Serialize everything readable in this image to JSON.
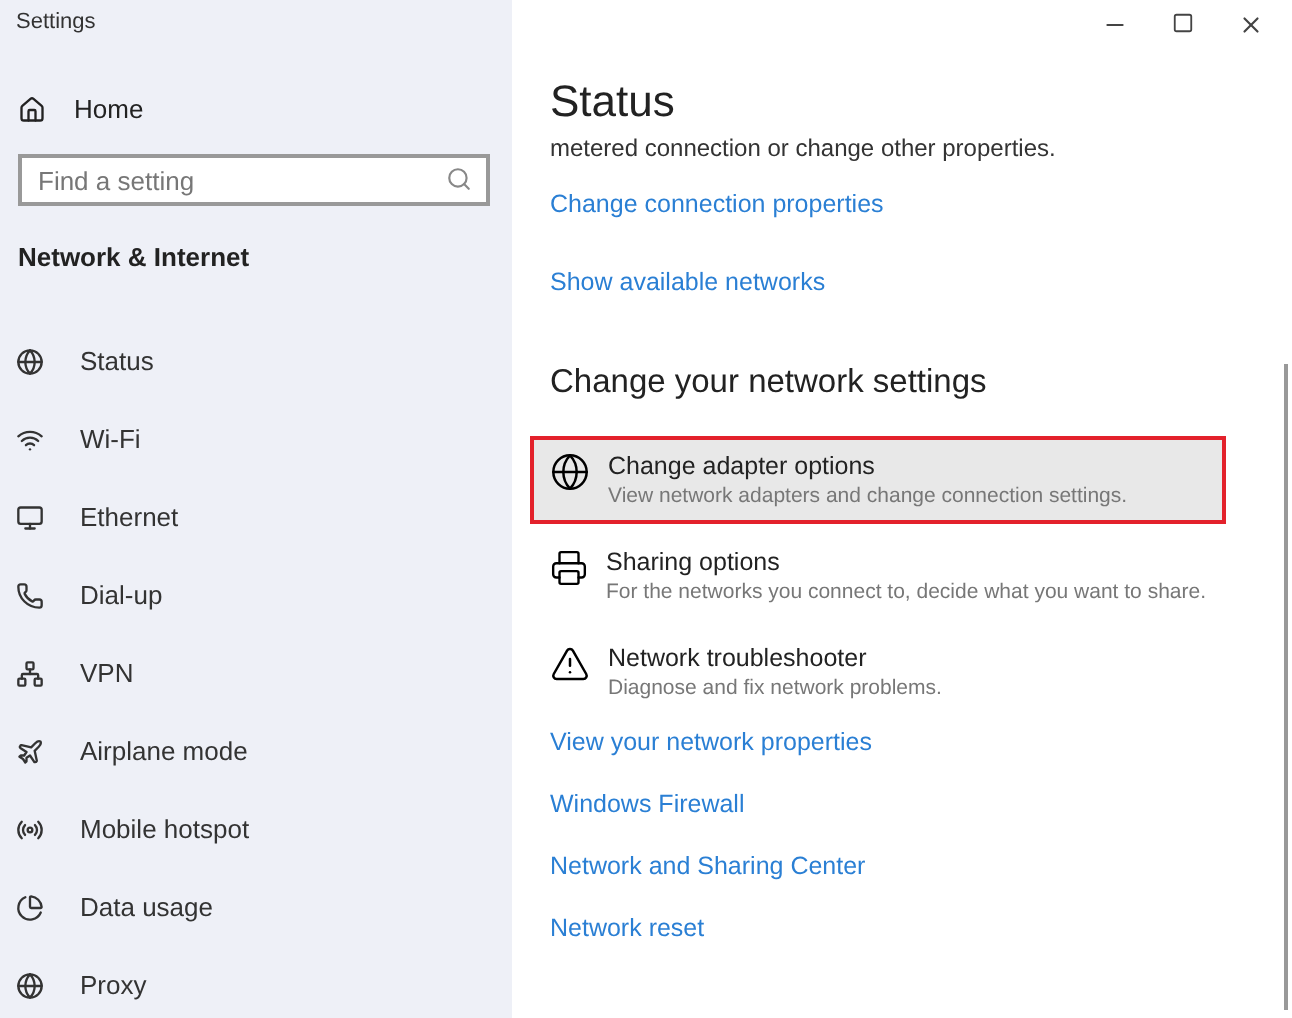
{
  "window": {
    "title": "Settings"
  },
  "sidebar": {
    "home": "Home",
    "search": {
      "placeholder": "Find a setting"
    },
    "section": "Network & Internet",
    "items": [
      {
        "label": "Status"
      },
      {
        "label": "Wi-Fi"
      },
      {
        "label": "Ethernet"
      },
      {
        "label": "Dial-up"
      },
      {
        "label": "VPN"
      },
      {
        "label": "Airplane mode"
      },
      {
        "label": "Mobile hotspot"
      },
      {
        "label": "Data usage"
      },
      {
        "label": "Proxy"
      }
    ]
  },
  "content": {
    "title": "Status",
    "text": "metered connection or change other properties.",
    "links_top": [
      "Change connection properties",
      "Show available networks"
    ],
    "section": "Change your network settings",
    "options": [
      {
        "title": "Change adapter options",
        "description": "View network adapters and change connection settings.",
        "selected": true
      },
      {
        "title": "Sharing options",
        "description": "For the networks you connect to, decide what you want to share.",
        "selected": false
      },
      {
        "title": "Network troubleshooter",
        "description": "Diagnose and fix network problems.",
        "selected": false
      }
    ],
    "links_bottom": [
      "View your network properties",
      "Windows Firewall",
      "Network and Sharing Center",
      "Network reset"
    ]
  }
}
